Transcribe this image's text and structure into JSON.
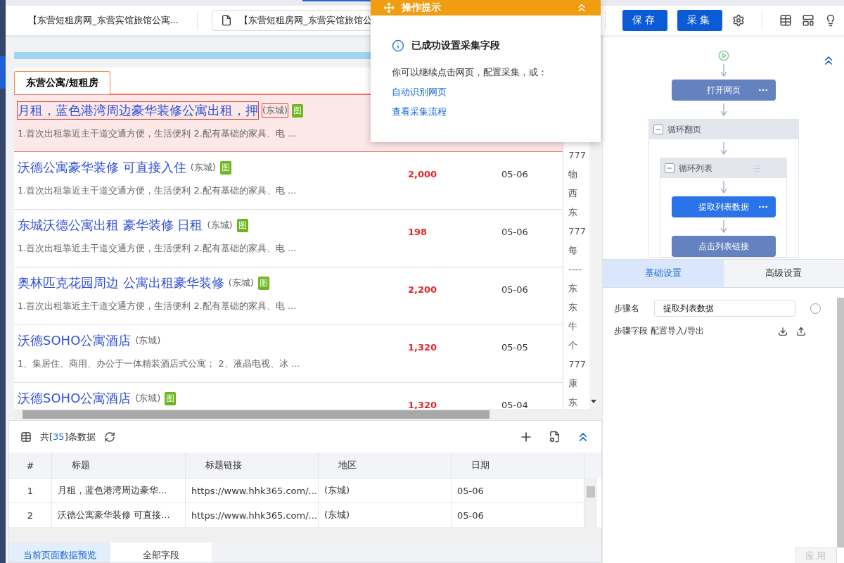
{
  "toolbar": {
    "page_title": "【东营短租房网_东营宾馆旅馆公寓...",
    "address": "【东营短租房网_东营宾馆旅馆公",
    "buttons": [
      {
        "label": "保存"
      },
      {
        "label": "采集"
      }
    ]
  },
  "webpage": {
    "tab": "东营公寓/短租房",
    "listings": [
      {
        "title": "月租，蓝色港湾周边豪华装修公寓出租，押",
        "area": "(东城)",
        "badge": "图",
        "desc": "1.首次出租靠近主干道交通方便，生活便利 2.配有基础的家具、电 ...",
        "selected": true
      },
      {
        "title": "沃德公寓豪华装修 可直接入住",
        "area": "(东城)",
        "badge": "图",
        "desc": "1.首次出租靠近主干道交通方便，生活便利 2.配有基础的家具、电 ...",
        "price": "2,000",
        "date": "05-06",
        "selected": false
      },
      {
        "title": "东城沃德公寓出租 豪华装修 日租",
        "area": "(东城)",
        "badge": "图",
        "desc": "1.首次出租靠近主干道交通方便，生活便利 2.配有基础的家具、电 ...",
        "price": "198",
        "date": "05-06",
        "selected": false
      },
      {
        "title": "奥林匹克花园周边 公寓出租豪华装修",
        "area": "(东城)",
        "badge": "图",
        "desc": "1.首次出租靠近主干道交通方便，生活便利 2.配有基础的家具、电 ...",
        "price": "2,200",
        "date": "05-06",
        "selected": false
      },
      {
        "title": "沃德SOHO公寓酒店",
        "area": "(东城)",
        "desc": "1、集居住、商用、办公于一体精装酒店式公寓； 2、液晶电视、冰 ...",
        "price": "1,320",
        "date": "05-05",
        "selected": false
      },
      {
        "title": "沃德SOHO公寓酒店",
        "area": "(东城)",
        "badge": "图",
        "price": "1,320",
        "date": "05-04",
        "selected": false
      }
    ],
    "side_items": [
      "777",
      "物",
      "西",
      "东",
      "777",
      "每",
      "----",
      "东",
      "东",
      "牛",
      "个",
      "777",
      "康",
      "东"
    ]
  },
  "popup": {
    "title": "操作提示",
    "heading": "已成功设置采集字段",
    "text": "你可以继续点击网页，配置采集，或：",
    "links": [
      "自动识别网页",
      "查看采集流程"
    ]
  },
  "preview": {
    "count_before": "共[",
    "count": "35",
    "count_after": "]条数据",
    "columns": [
      "#",
      "标题",
      "标题链接",
      "地区",
      "日期"
    ],
    "rows": [
      [
        "1",
        "月租，蓝色港湾周边豪华...",
        "https://www.hhk365.com/...",
        "(东城)",
        "05-06"
      ],
      [
        "2",
        "沃德公寓豪华装修 可直接...",
        "https://www.hhk365.com/...",
        "(东城)",
        "05-06"
      ]
    ],
    "tabs": [
      {
        "label": "当前页面数据预览",
        "selected": true
      },
      {
        "label": "全部字段",
        "selected": false
      }
    ]
  },
  "flow": {
    "open_node": {
      "label": "打开网页",
      "selected": false
    },
    "loop_page": "循环翻页",
    "loop_list": "循环列表",
    "inner_nodes": [
      {
        "label": "提取列表数据",
        "selected": true,
        "menu": true
      },
      {
        "label": "点击列表链接",
        "selected": false,
        "menu": false
      }
    ]
  },
  "settings": {
    "tabs": [
      {
        "label": "基础设置",
        "selected": true
      },
      {
        "label": "高级设置",
        "selected": false
      }
    ],
    "step_name_label": "步骤名",
    "step_name": "提取列表数据",
    "fields_label": "步骤字段 配置导入/导出",
    "apply": {
      "label": "应用",
      "disabled": true
    }
  }
}
